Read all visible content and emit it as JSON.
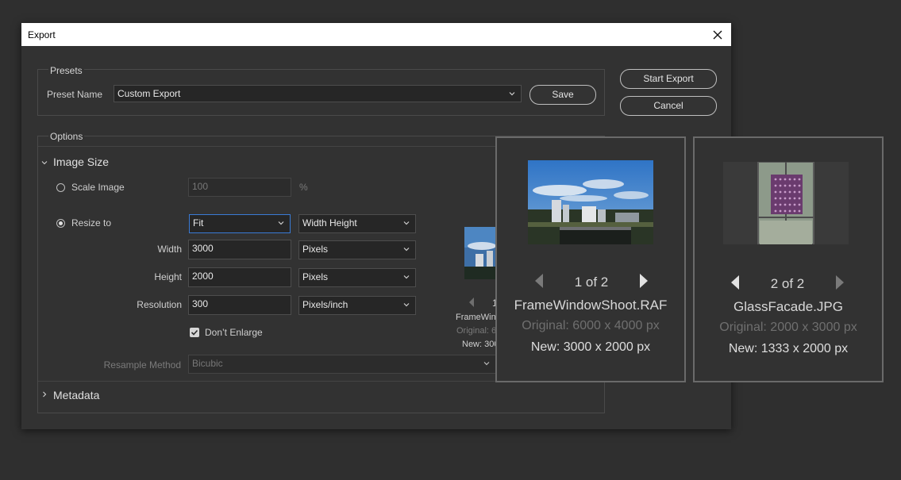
{
  "dialog": {
    "title": "Export"
  },
  "presets": {
    "group_label": "Presets",
    "preset_name_label": "Preset Name",
    "preset_name_value": "Custom Export",
    "save_label": "Save"
  },
  "actions": {
    "start_export": "Start Export",
    "cancel": "Cancel"
  },
  "options": {
    "group_label": "Options",
    "image_size": {
      "section_label": "Image Size",
      "scale_image_label": "Scale Image",
      "scale_value": "100",
      "percent_unit": "%",
      "resize_to_label": "Resize to",
      "resize_mode": "Fit",
      "fit_dimension": "Width Height",
      "width_label": "Width",
      "width_value": "3000",
      "width_unit": "Pixels",
      "height_label": "Height",
      "height_value": "2000",
      "height_unit": "Pixels",
      "resolution_label": "Resolution",
      "resolution_value": "300",
      "resolution_unit": "Pixels/inch",
      "dont_enlarge_label": "Don’t Enlarge",
      "dont_enlarge_checked": true,
      "resample_label": "Resample Method",
      "resample_value": "Bicubic"
    },
    "metadata": {
      "section_label": "Metadata"
    }
  },
  "inline_preview": {
    "counter": "1",
    "name": "FrameWind",
    "original": "Original: 6",
    "new": "New: 300"
  },
  "previews": [
    {
      "counter": "1 of 2",
      "filename": "FrameWindowShoot.RAF",
      "original": "Original: 6000 x 4000 px",
      "new": "New: 3000 x 2000 px"
    },
    {
      "counter": "2 of 2",
      "filename": "GlassFacade.JPG",
      "original": "Original: 2000 x 3000 px",
      "new": "New: 1333 x 2000 px"
    }
  ],
  "colors": {
    "background": "#2f2f2f",
    "dialog": "#323232",
    "titlebar": "#ffffff",
    "focus_border": "#3a7bd5"
  }
}
